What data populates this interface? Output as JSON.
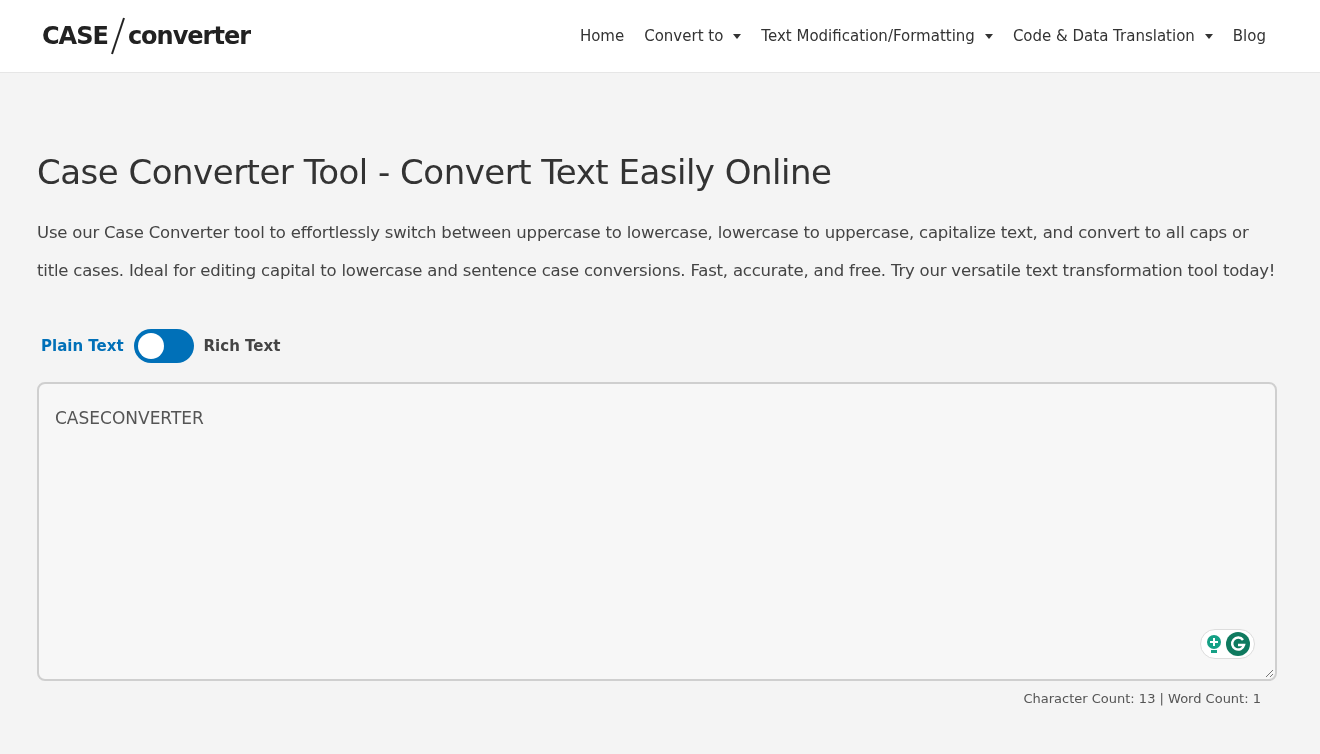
{
  "logo": {
    "left": "CASE",
    "right": "converter"
  },
  "nav": [
    {
      "label": "Home",
      "dropdown": false
    },
    {
      "label": "Convert to",
      "dropdown": true
    },
    {
      "label": "Text Modification/Formatting",
      "dropdown": true
    },
    {
      "label": "Code & Data Translation",
      "dropdown": true
    },
    {
      "label": "Blog",
      "dropdown": false
    }
  ],
  "title": "Case Converter Tool - Convert Text Easily Online",
  "intro": "Use our Case Converter tool to effortlessly switch between uppercase to lowercase, lowercase to uppercase, capitalize text, and convert to all caps or title cases. Ideal for editing capital to lowercase and sentence case conversions. Fast, accurate, and free. Try our versatile text transformation tool today!",
  "mode_toggle": {
    "left_label": "Plain Text",
    "right_label": "Rich Text",
    "on": false
  },
  "editor": {
    "value": "CASECONVERTER"
  },
  "counts": "Character Count: 13 | Word Count: 1"
}
